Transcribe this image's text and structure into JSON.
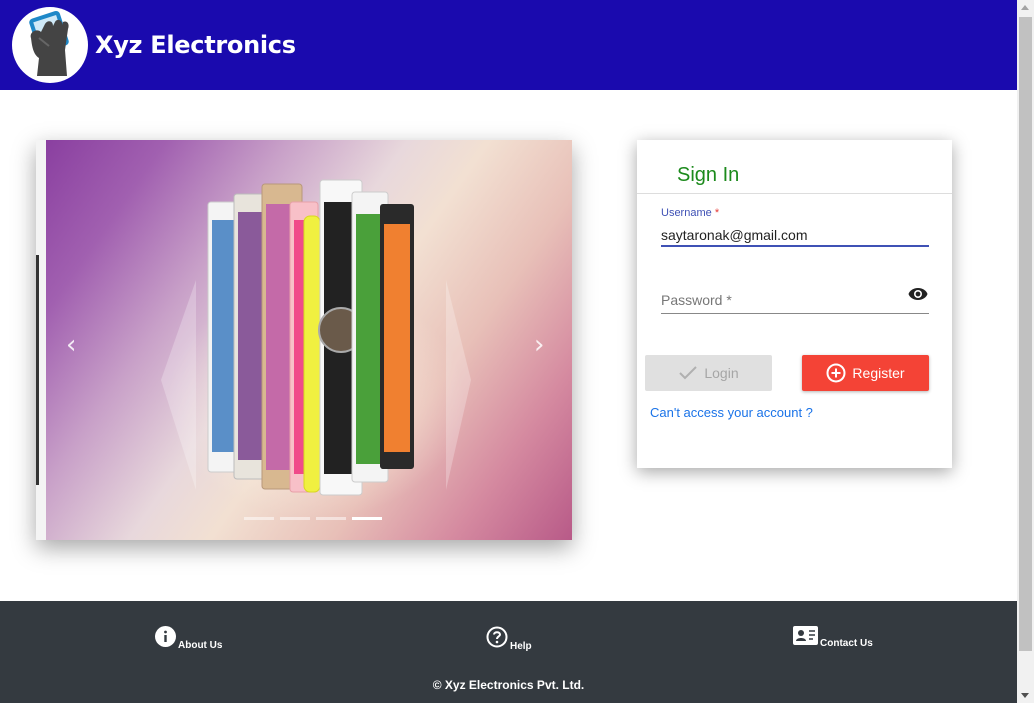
{
  "header": {
    "brand": "Xyz Electronics",
    "logo_icon": "phone-in-hand-icon",
    "background": "#1a0aae"
  },
  "carousel": {
    "prev_icon": "chevron-left-icon",
    "next_icon": "chevron-right-icon",
    "prev_glyph": "‹",
    "next_glyph": "›",
    "slide_count": 4,
    "active_slide": 4
  },
  "signin": {
    "title": "Sign In",
    "username": {
      "label": "Username",
      "required_mark": "*",
      "value": "saytaronak@gmail.com"
    },
    "password": {
      "placeholder": "Password *",
      "toggle_icon": "eye-icon"
    },
    "login_label": "Login",
    "register_label": "Register",
    "forgot_link": "Can't access your account ?"
  },
  "footer": {
    "links": [
      {
        "label": "About Us",
        "icon": "info-icon"
      },
      {
        "label": "Help",
        "icon": "help-icon"
      },
      {
        "label": "Contact Us",
        "icon": "contact-card-icon"
      }
    ],
    "copyright": "© Xyz Electronics Pvt. Ltd."
  },
  "colors": {
    "title_green": "#1c8a1c",
    "accent_blue": "#3f51b5",
    "register_red": "#f44336",
    "link_blue": "#1a73e8",
    "footer_bg": "#343a40"
  }
}
